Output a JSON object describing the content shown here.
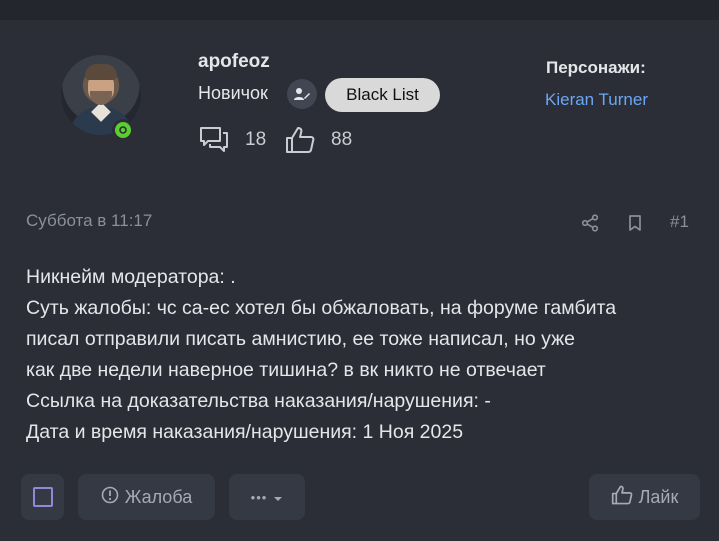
{
  "user": {
    "username": "apofeoz",
    "rank": "Новичок",
    "badge": "Black List",
    "messages_count": "18",
    "likes_count": "88"
  },
  "characters": {
    "title": "Персонажи:",
    "name": "Kieran Turner"
  },
  "post": {
    "date": "Суббота в 11:17",
    "number": "#1",
    "lines": [
      "Никнейм модератора: .",
      "Суть жалобы: чс са-ес хотел бы обжаловать, на форуме гамбита",
      "писал отправили писать амнистию, ее тоже написал, но уже",
      "как две недели наверное тишина? в вк никто не отвечает",
      "Ссылка на доказательства наказания/нарушения: -",
      "Дата и время наказания/нарушения: 1 Ноя 2025"
    ]
  },
  "actions": {
    "report_label": "Жалоба",
    "more_label": "•••",
    "like_label": "Лайк"
  },
  "colors": {
    "background": "#2b2e36",
    "link": "#6ba6f2",
    "online": "#5bcf2f",
    "badge_bg": "#d9d9d9"
  }
}
